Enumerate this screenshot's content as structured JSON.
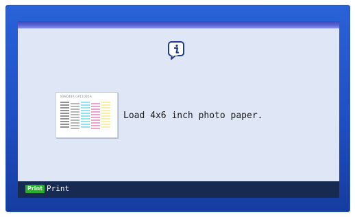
{
  "dialog": {
    "icon": "info-icon",
    "thumbnail_label": "NP8048R  GP11085A",
    "message": "Load 4x6 inch photo paper."
  },
  "footer": {
    "key_label": "Print",
    "action_label": "Print"
  },
  "colors": {
    "screen_bg": "#1f4fc4",
    "panel_bg": "#dfe6f5",
    "footer_bg": "#162a52",
    "print_key": "#27b12b"
  }
}
